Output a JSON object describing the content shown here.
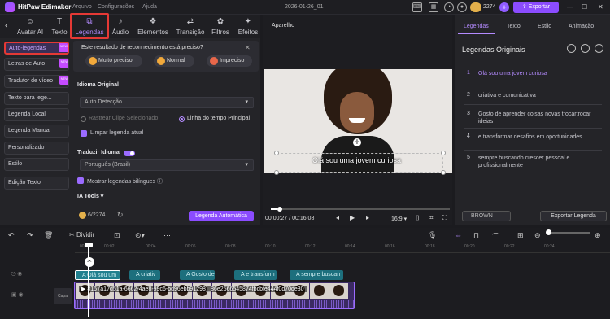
{
  "app": {
    "name": "HitPaw Edimakor",
    "menu": [
      "Arquivo",
      "Configurações",
      "Ajuda"
    ],
    "doc_title": "2026-01-26_01",
    "coins": "2274",
    "export_label": "Exportar"
  },
  "tabs": [
    {
      "label": "Avatar AI",
      "icon": "avatar-icon"
    },
    {
      "label": "Texto",
      "icon": "text-icon"
    },
    {
      "label": "Legendas",
      "icon": "subtitles-icon",
      "active": true
    },
    {
      "label": "Áudio",
      "icon": "music-icon"
    },
    {
      "label": "Elementos",
      "icon": "elements-icon"
    },
    {
      "label": "Transição",
      "icon": "transition-icon"
    },
    {
      "label": "Filtros",
      "icon": "filters-icon"
    },
    {
      "label": "Efeitos",
      "icon": "effects-icon"
    }
  ],
  "sidebar": [
    {
      "label": "Auto-legendas",
      "new": true,
      "active": true
    },
    {
      "label": "Letras de Auto",
      "new": true
    },
    {
      "label": "Tradutor de vídeo",
      "new": true
    },
    {
      "label": "Texto para lege..."
    },
    {
      "label": "Legenda Local"
    },
    {
      "label": "Legenda Manual"
    },
    {
      "label": "Personalizado"
    },
    {
      "label": "Estilo"
    },
    {
      "label": "Edição Texto"
    }
  ],
  "new_badge": "NEW",
  "feedback": {
    "question": "Este resultado de reconhecimento está preciso?",
    "options": [
      "Muito preciso",
      "Normal",
      "Impreciso"
    ]
  },
  "settings": {
    "language_title": "Idioma Original",
    "language_value": "Auto Detecção",
    "radio_selected_clip": "Rastrear Clipe Selecionado",
    "radio_main_timeline": "Linha do tempo Principal",
    "clear_label": "Limpar legenda atual",
    "translate_title": "Traduzir Idioma",
    "translate_value": "Português (Brasil)",
    "bilingual_label": "Mostrar legendas bilíngues",
    "ia_tools": "IA Tools",
    "usage": "6/2274",
    "auto_button": "Legenda Automática"
  },
  "player": {
    "title": "Aparelho",
    "caption": "Olá  sou uma jovem curiosa",
    "current": "00:00:27",
    "total": "00:16:08",
    "ratio": "16:9",
    "progress": 0.03
  },
  "right": {
    "tabs": [
      "Legendas",
      "Texto",
      "Estilo",
      "Animação"
    ],
    "title": "Legendas Originais",
    "subtitles": [
      {
        "n": "1",
        "text": "Olá  sou uma jovem curiosa"
      },
      {
        "n": "2",
        "text": "criativa e comunicativa"
      },
      {
        "n": "3",
        "text": "Gosto de aprender coisas novas trocartrocar ideias"
      },
      {
        "n": "4",
        "text": "e transformar desafios em oportunidades"
      },
      {
        "n": "5",
        "text": "sempre buscando crescer pessoal e profissionalmente"
      }
    ],
    "style_label": "BROWN",
    "export_label": "Exportar Legenda"
  },
  "timeline": {
    "split_label": "Dividir",
    "ticks": [
      "00:00",
      "00:02",
      "00:04",
      "00:06",
      "00:08",
      "00:10",
      "00:12",
      "00:14",
      "00:16",
      "00:18",
      "00:20",
      "00:22",
      "00:24"
    ],
    "clips": [
      "Olá  sou um",
      "criativ",
      "Gosto de",
      "e transform",
      "sempre buscan"
    ],
    "video_label": "816 (a17d51a-6662-4ae8-99c6-bd96ebb91298)_86e2566545874fbcbfe444f0d70de30",
    "cover_label": "Capa"
  }
}
